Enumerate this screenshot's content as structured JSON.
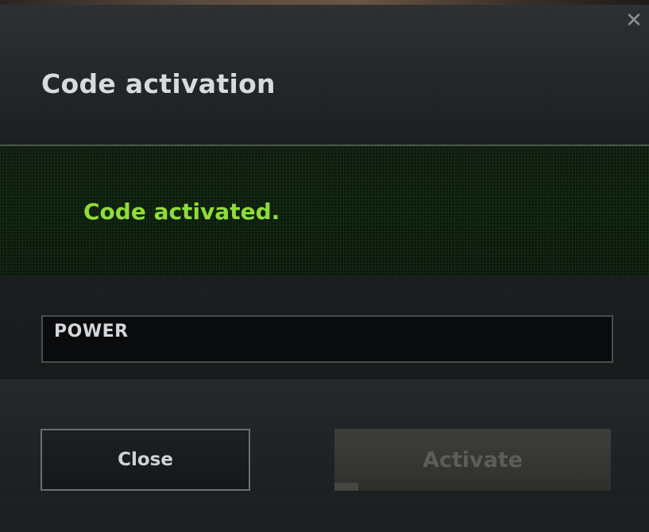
{
  "dialog": {
    "title": "Code activation",
    "close_icon": "close-icon",
    "close_glyph": "✕"
  },
  "status": {
    "message": "Code activated.",
    "color": "#8fdc3a"
  },
  "code_input": {
    "value": "POWER"
  },
  "buttons": {
    "close_label": "Close",
    "activate_label": "Activate",
    "activate_enabled": false
  }
}
